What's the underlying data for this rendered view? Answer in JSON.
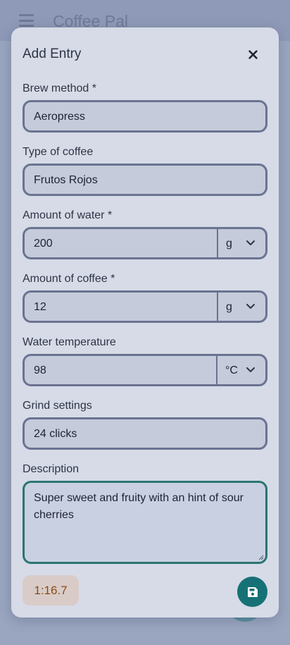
{
  "app": {
    "title": "Coffee Pal"
  },
  "dialog": {
    "title": "Add Entry",
    "fields": {
      "brew_method": {
        "label": "Brew method *",
        "value": "Aeropress"
      },
      "coffee_type": {
        "label": "Type of coffee",
        "value": "Frutos Rojos"
      },
      "water_amount": {
        "label": "Amount of water *",
        "value": "200",
        "unit": "g"
      },
      "coffee_amount": {
        "label": "Amount of coffee *",
        "value": "12",
        "unit": "g"
      },
      "water_temp": {
        "label": "Water temperature",
        "value": "98",
        "unit": "°C"
      },
      "grind": {
        "label": "Grind settings",
        "value": "24 clicks"
      },
      "description": {
        "label": "Description",
        "value": "Super sweet and fruity with an hint of sour cherries"
      }
    },
    "ratio": "1:16.7"
  },
  "icons": {
    "menu": "hamburger-icon",
    "close": "close-icon",
    "dropdown": "chevron-down-icon",
    "save": "floppy-disk-icon"
  },
  "colors": {
    "accent": "#167176",
    "field_border": "#6a7391",
    "focus_border": "#2b7570",
    "ratio_text": "#8a4a18"
  }
}
